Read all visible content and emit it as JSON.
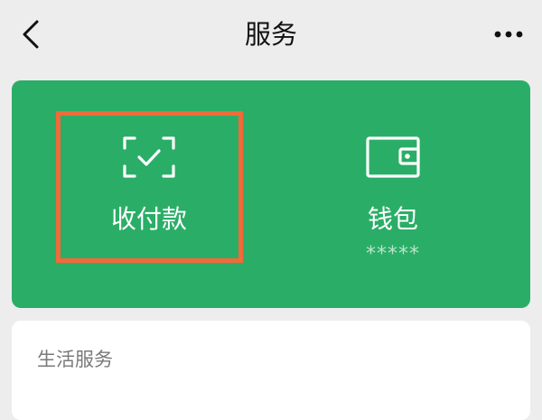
{
  "header": {
    "title": "服务",
    "back_icon": "chevron-left-icon",
    "more_icon": "more-horizontal-icon"
  },
  "payment_card": {
    "background_color": "#2aae67",
    "pay": {
      "label": "收付款",
      "icon": "scan-check-icon"
    },
    "wallet": {
      "label": "钱包",
      "balance_masked": "*****",
      "icon": "wallet-icon"
    },
    "highlight_color": "#f06a3a"
  },
  "life_services": {
    "title": "生活服务"
  }
}
